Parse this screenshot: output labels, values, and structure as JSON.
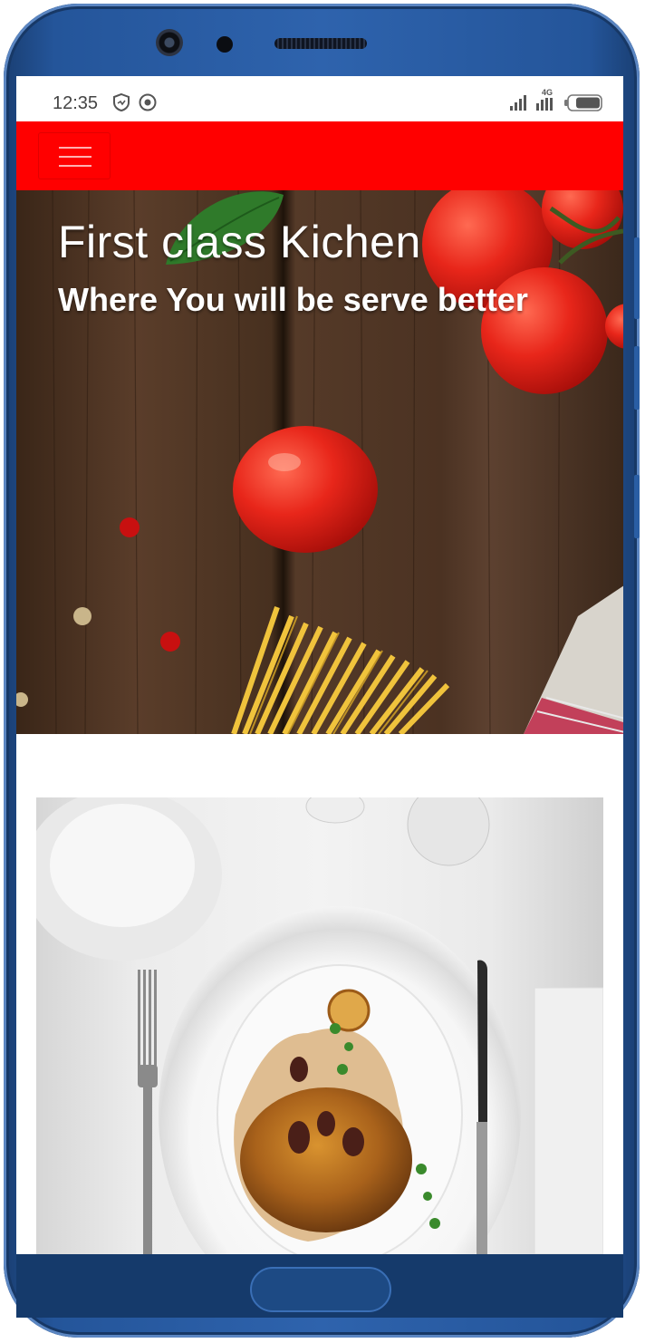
{
  "status_bar": {
    "time": "12:35",
    "network_label": "4G"
  },
  "navbar": {
    "color": "#ff0000"
  },
  "hero": {
    "title": "First class Kichen",
    "subtitle": "Where You will be serve better"
  },
  "icons": [
    "menu-icon",
    "shield-icon",
    "record-icon",
    "signal-icon",
    "battery-icon"
  ]
}
